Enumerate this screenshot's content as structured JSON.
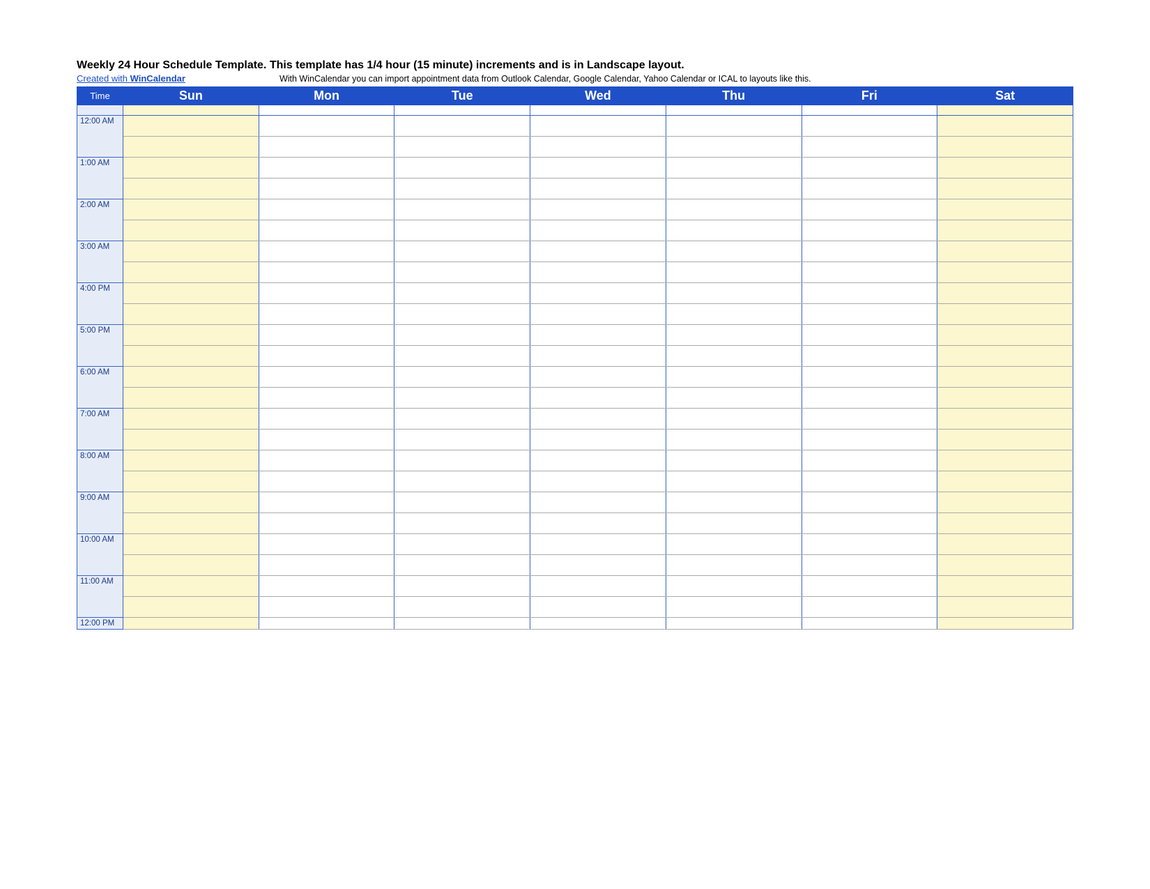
{
  "title": "Weekly 24 Hour Schedule Template.  This template has 1/4 hour (15 minute) increments and is in Landscape layout.",
  "link_prefix": "Created with ",
  "link_brand": "WinCalendar",
  "note": "With WinCalendar you can import appointment data from Outlook Calendar, Google Calendar, Yahoo Calendar or ICAL to layouts like this.",
  "time_header": "Time",
  "days": [
    "Sun",
    "Mon",
    "Tue",
    "Wed",
    "Thu",
    "Fri",
    "Sat"
  ],
  "hours": [
    "12:00 AM",
    "1:00 AM",
    "2:00 AM",
    "3:00 AM",
    "4:00 PM",
    "5:00 PM",
    "6:00 AM",
    "7:00 AM",
    "8:00 AM",
    "9:00 AM",
    "10:00 AM",
    "11:00 AM",
    "12:00 PM"
  ]
}
